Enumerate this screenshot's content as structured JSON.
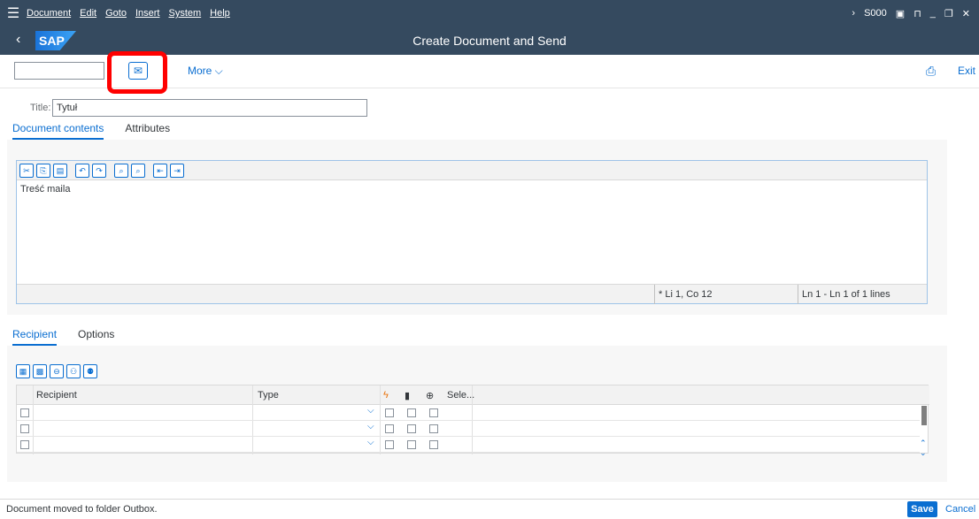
{
  "menu": {
    "items": [
      "Document",
      "Edit",
      "Goto",
      "Insert",
      "System",
      "Help"
    ],
    "system_id": "S000"
  },
  "titlebar": {
    "logo_text": "SAP",
    "title": "Create Document and Send"
  },
  "toolbar": {
    "command_value": "",
    "more_label": "More",
    "exit_label": "Exit"
  },
  "document": {
    "title_label": "Title:",
    "title_value": "Tytuł",
    "tabs": [
      "Document contents",
      "Attributes"
    ],
    "body_text": "Treść maila",
    "status_asterisk": "*",
    "status_position": "Li 1, Co 12",
    "status_lines": "Ln 1 - Ln 1 of 1 lines"
  },
  "recipients": {
    "tabs": [
      "Recipient",
      "Options"
    ],
    "columns": [
      "Recipient",
      "Type",
      "Sele..."
    ],
    "rows": [
      {
        "recipient": "",
        "type": ""
      },
      {
        "recipient": "",
        "type": ""
      },
      {
        "recipient": "",
        "type": ""
      }
    ]
  },
  "footer": {
    "message": "Document moved to folder Outbox.",
    "save_label": "Save",
    "cancel_label": "Cancel"
  },
  "colors": {
    "shell": "#354a5f",
    "accent": "#0a6ed1",
    "highlight": "#ff0000"
  }
}
